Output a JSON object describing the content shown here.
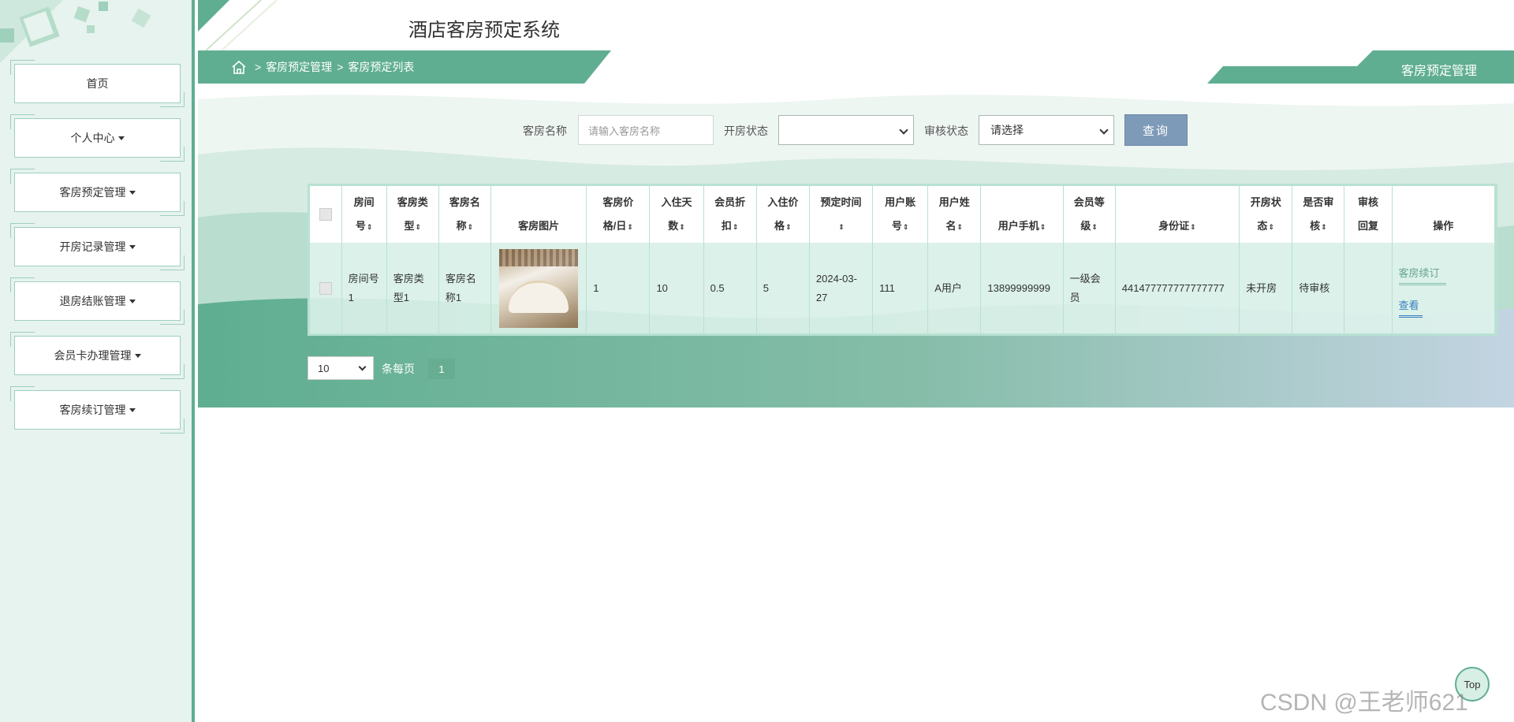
{
  "header": {
    "title": "酒店客房预定系统"
  },
  "sidebar": {
    "items": [
      {
        "label": "首页",
        "has_caret": false
      },
      {
        "label": "个人中心",
        "has_caret": true
      },
      {
        "label": "客房预定管理",
        "has_caret": true
      },
      {
        "label": "开房记录管理",
        "has_caret": true
      },
      {
        "label": "退房结账管理",
        "has_caret": true
      },
      {
        "label": "会员卡办理管理",
        "has_caret": true
      },
      {
        "label": "客房续订管理",
        "has_caret": true
      }
    ]
  },
  "breadcrumb": {
    "sep": ">",
    "items": [
      "客房预定管理",
      "客房预定列表"
    ]
  },
  "page_badge": "客房预定管理",
  "search": {
    "room_name_label": "客房名称",
    "room_name_placeholder": "请输入客房名称",
    "checkin_status_label": "开房状态",
    "checkin_status_value": "",
    "audit_status_label": "审核状态",
    "audit_status_value": "请选择",
    "submit_label": "查询"
  },
  "table": {
    "headers": [
      {
        "line1": "房间",
        "line2": "号"
      },
      {
        "line1": "客房类",
        "line2": "型"
      },
      {
        "line1": "客房名",
        "line2": "称"
      },
      {
        "line1": "",
        "line2": "客房图片"
      },
      {
        "line1": "客房价",
        "line2": "格/日"
      },
      {
        "line1": "入住天",
        "line2": "数"
      },
      {
        "line1": "会员折",
        "line2": "扣"
      },
      {
        "line1": "入住价",
        "line2": "格"
      },
      {
        "line1": "预定时间",
        "line2": ""
      },
      {
        "line1": "用户账",
        "line2": "号"
      },
      {
        "line1": "用户姓",
        "line2": "名"
      },
      {
        "line1": "",
        "line2": "用户手机"
      },
      {
        "line1": "会员等",
        "line2": "级"
      },
      {
        "line1": "",
        "line2": "身份证"
      },
      {
        "line1": "开房状",
        "line2": "态"
      },
      {
        "line1": "是否审",
        "line2": "核"
      },
      {
        "line1": "审核",
        "line2": "回复"
      },
      {
        "line1": "",
        "line2": "操作"
      }
    ],
    "sort_icon": "⇕",
    "rows": [
      {
        "room_no": "房间号1",
        "room_type": "客房类型1",
        "room_name": "客房名称1",
        "price": "1",
        "days": "10",
        "discount": "0.5",
        "checkin_price": "5",
        "reserve_time": "2024-03-27",
        "account": "111",
        "user_name": "A用户",
        "phone": "13899999999",
        "member_level": "一级会员",
        "id_card": "441477777777777777",
        "checkin_status": "未开房",
        "audited": "待审核",
        "reply": "",
        "actions": {
          "renew": "客房续订",
          "view": "查看"
        }
      }
    ]
  },
  "pager": {
    "page_size": "10",
    "per_page_label": "条每页",
    "current_page": "1"
  },
  "top_button": "Top",
  "watermark": "CSDN @王老师621",
  "colors": {
    "brand_green": "#5fae91",
    "sidebar_bg": "#e6f3ee",
    "search_button": "#7d9ab8",
    "link_blue": "#3a7fbf"
  }
}
